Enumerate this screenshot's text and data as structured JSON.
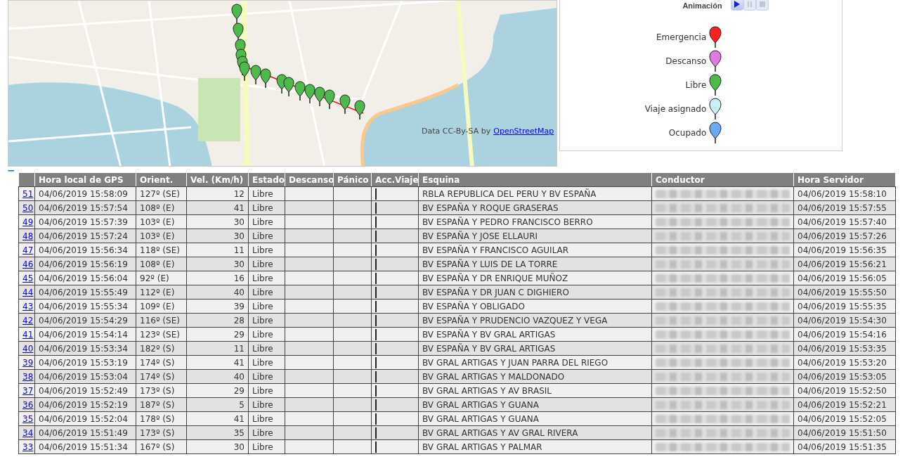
{
  "map": {
    "attribution": "Data CC-By-SA by",
    "attribution_link": "OpenStreetMap"
  },
  "legend": {
    "animation_label": "Animación",
    "controls": [
      {
        "kind": "play",
        "disabled": false
      },
      {
        "kind": "pause",
        "disabled": true
      },
      {
        "kind": "stop",
        "disabled": true
      }
    ],
    "items": [
      {
        "label": "Emergencia",
        "color": "#ff2020"
      },
      {
        "label": "Descanso",
        "color": "#e07ae0"
      },
      {
        "label": "Libre",
        "color": "#4cbb4c"
      },
      {
        "label": "Viaje asignado",
        "color": "#c8f0f5"
      },
      {
        "label": "Ocupado",
        "color": "#6aaaf5"
      }
    ]
  },
  "collapse_toggle": "−",
  "table": {
    "columns": [
      "",
      "Hora local de GPS",
      "Orient.",
      "Vel. (Km/h)",
      "Estado",
      "Descanso",
      "Pánico",
      "Acc.Viaje",
      "Esquina",
      "Conductor",
      "Hora Servidor"
    ],
    "rows": [
      {
        "id": "51",
        "gps_time": "04/06/2019 15:58:09",
        "orient": "127º (SE)",
        "speed": "12",
        "state": "Libre",
        "corner": "RBLA REPUBLICA DEL PERU Y BV ESPAÑA",
        "server_time": "04/06/2019 15:58:10"
      },
      {
        "id": "50",
        "gps_time": "04/06/2019 15:57:54",
        "orient": "108º (E)",
        "speed": "41",
        "state": "Libre",
        "corner": "BV ESPAÑA Y ROQUE GRASERAS",
        "server_time": "04/06/2019 15:57:55"
      },
      {
        "id": "49",
        "gps_time": "04/06/2019 15:57:39",
        "orient": "103º (E)",
        "speed": "30",
        "state": "Libre",
        "corner": "BV ESPAÑA Y PEDRO FRANCISCO BERRO",
        "server_time": "04/06/2019 15:57:40"
      },
      {
        "id": "48",
        "gps_time": "04/06/2019 15:57:24",
        "orient": "103º (E)",
        "speed": "30",
        "state": "Libre",
        "corner": "BV ESPAÑA Y JOSE ELLAURI",
        "server_time": "04/06/2019 15:57:26"
      },
      {
        "id": "47",
        "gps_time": "04/06/2019 15:56:34",
        "orient": "118º (SE)",
        "speed": "11",
        "state": "Libre",
        "corner": "BV ESPAÑA Y FRANCISCO AGUILAR",
        "server_time": "04/06/2019 15:56:35"
      },
      {
        "id": "46",
        "gps_time": "04/06/2019 15:56:19",
        "orient": "108º (E)",
        "speed": "30",
        "state": "Libre",
        "corner": "BV ESPAÑA Y LUIS DE LA TORRE",
        "server_time": "04/06/2019 15:56:21"
      },
      {
        "id": "45",
        "gps_time": "04/06/2019 15:56:04",
        "orient": "92º (E)",
        "speed": "16",
        "state": "Libre",
        "corner": "BV ESPAÑA Y DR ENRIQUE MUÑOZ",
        "server_time": "04/06/2019 15:56:05"
      },
      {
        "id": "44",
        "gps_time": "04/06/2019 15:55:49",
        "orient": "112º (E)",
        "speed": "40",
        "state": "Libre",
        "corner": "BV ESPAÑA Y DR JUAN C DIGHIERO",
        "server_time": "04/06/2019 15:55:50"
      },
      {
        "id": "43",
        "gps_time": "04/06/2019 15:55:34",
        "orient": "109º (E)",
        "speed": "39",
        "state": "Libre",
        "corner": "BV ESPAÑA Y OBLIGADO",
        "server_time": "04/06/2019 15:55:35"
      },
      {
        "id": "42",
        "gps_time": "04/06/2019 15:54:29",
        "orient": "116º (SE)",
        "speed": "28",
        "state": "Libre",
        "corner": "BV ESPAÑA Y PRUDENCIO VAZQUEZ Y VEGA",
        "server_time": "04/06/2019 15:54:30"
      },
      {
        "id": "41",
        "gps_time": "04/06/2019 15:54:14",
        "orient": "123º (SE)",
        "speed": "29",
        "state": "Libre",
        "corner": "BV ESPAÑA Y BV GRAL ARTIGAS",
        "server_time": "04/06/2019 15:54:16"
      },
      {
        "id": "40",
        "gps_time": "04/06/2019 15:53:34",
        "orient": "182º (S)",
        "speed": "11",
        "state": "Libre",
        "corner": "BV ESPAÑA Y BV GRAL ARTIGAS",
        "server_time": "04/06/2019 15:53:35"
      },
      {
        "id": "39",
        "gps_time": "04/06/2019 15:53:19",
        "orient": "174º (S)",
        "speed": "41",
        "state": "Libre",
        "corner": "BV GRAL ARTIGAS Y JUAN PARRA DEL RIEGO",
        "server_time": "04/06/2019 15:53:20"
      },
      {
        "id": "38",
        "gps_time": "04/06/2019 15:53:04",
        "orient": "174º (S)",
        "speed": "40",
        "state": "Libre",
        "corner": "BV GRAL ARTIGAS Y MALDONADO",
        "server_time": "04/06/2019 15:53:05"
      },
      {
        "id": "37",
        "gps_time": "04/06/2019 15:52:49",
        "orient": "173º (S)",
        "speed": "29",
        "state": "Libre",
        "corner": "BV GRAL ARTIGAS Y AV BRASIL",
        "server_time": "04/06/2019 15:52:50"
      },
      {
        "id": "36",
        "gps_time": "04/06/2019 15:52:19",
        "orient": "187º (S)",
        "speed": "5",
        "state": "Libre",
        "corner": "BV GRAL ARTIGAS Y GUANA",
        "server_time": "04/06/2019 15:52:21"
      },
      {
        "id": "35",
        "gps_time": "04/06/2019 15:52:04",
        "orient": "178º (S)",
        "speed": "41",
        "state": "Libre",
        "corner": "BV GRAL ARTIGAS Y GUANA",
        "server_time": "04/06/2019 15:52:05"
      },
      {
        "id": "34",
        "gps_time": "04/06/2019 15:51:49",
        "orient": "173º (S)",
        "speed": "35",
        "state": "Libre",
        "corner": "BV GRAL ARTIGAS Y AV GRAL RIVERA",
        "server_time": "04/06/2019 15:51:50"
      },
      {
        "id": "33",
        "gps_time": "04/06/2019 15:51:34",
        "orient": "167º (S)",
        "speed": "30",
        "state": "Libre",
        "corner": "BV GRAL ARTIGAS Y PALMAR",
        "server_time": "04/06/2019 15:51:35"
      }
    ]
  }
}
